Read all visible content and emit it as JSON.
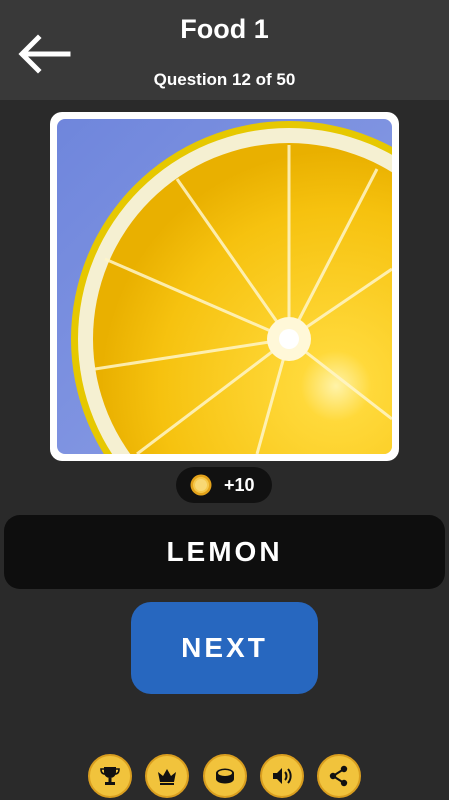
{
  "header": {
    "title": "Food 1",
    "subtitle": "Question 12 of 50",
    "back_icon": "arrow-left-icon"
  },
  "question": {
    "image_subject": "lemon slice",
    "reward": "+10",
    "reward_icon": "coin-icon",
    "answer": "LEMON"
  },
  "actions": {
    "next_label": "NEXT"
  },
  "bottom_bar": {
    "icons": [
      "trophy-icon",
      "crown-icon",
      "coins-icon",
      "sound-icon",
      "share-icon"
    ]
  },
  "colors": {
    "background": "#2a2a2a",
    "header": "#393939",
    "next_button": "#2767bf",
    "icon_button": "#f1c33c",
    "answer_box": "#0e0e0e"
  }
}
